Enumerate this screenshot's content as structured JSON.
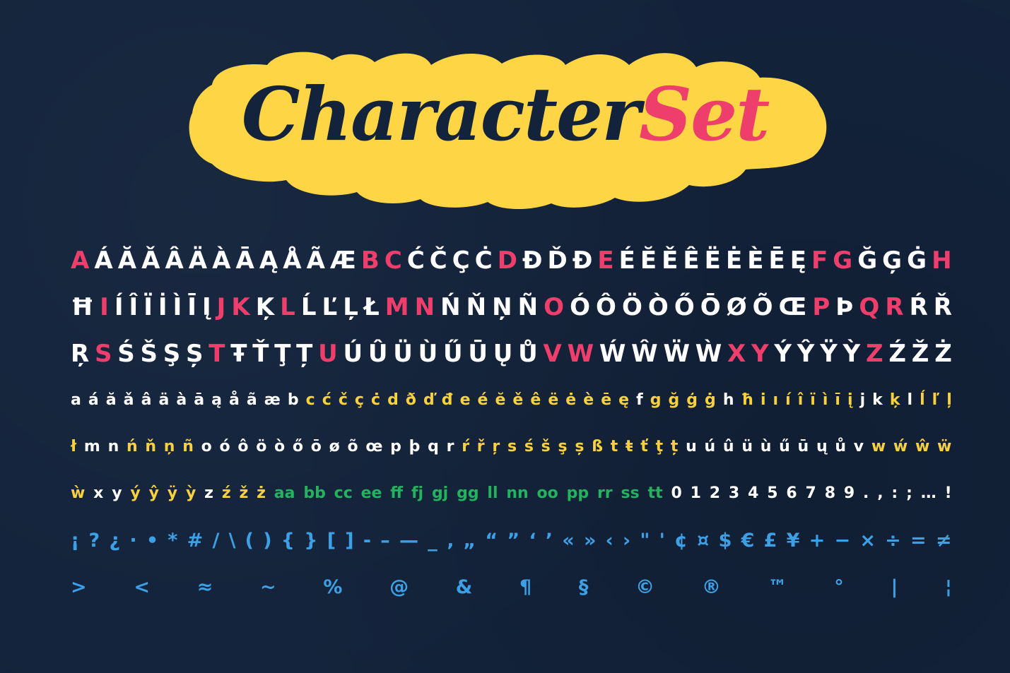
{
  "title": {
    "word1": "Character",
    "word2": "Set"
  },
  "colors": {
    "background": "#13233b",
    "cloud": "#fdd545",
    "pink": "#ee3e6c",
    "white": "#ffffff",
    "yellow": "#f9d13e",
    "green": "#22b35d",
    "blue": "#3da0e6"
  },
  "rows": [
    [
      [
        "A",
        "pink"
      ],
      [
        "Á",
        "white"
      ],
      [
        "Ă",
        "white"
      ],
      [
        "Ǎ",
        "white"
      ],
      [
        "Â",
        "white"
      ],
      [
        "Ä",
        "white"
      ],
      [
        "À",
        "white"
      ],
      [
        "Ā",
        "white"
      ],
      [
        "Ą",
        "white"
      ],
      [
        "Å",
        "white"
      ],
      [
        "Ã",
        "white"
      ],
      [
        "Æ",
        "white"
      ],
      [
        "B",
        "pink"
      ],
      [
        "C",
        "pink"
      ],
      [
        "Ć",
        "white"
      ],
      [
        "Č",
        "white"
      ],
      [
        "Ç",
        "white"
      ],
      [
        "Ċ",
        "white"
      ],
      [
        "D",
        "pink"
      ],
      [
        "Đ",
        "white"
      ],
      [
        "Ď",
        "white"
      ],
      [
        "Đ",
        "white"
      ],
      [
        "E",
        "pink"
      ],
      [
        "É",
        "white"
      ],
      [
        "Ĕ",
        "white"
      ],
      [
        "Ě",
        "white"
      ],
      [
        "Ê",
        "white"
      ],
      [
        "Ë",
        "white"
      ],
      [
        "Ė",
        "white"
      ],
      [
        "È",
        "white"
      ],
      [
        "Ē",
        "white"
      ],
      [
        "Ę",
        "white"
      ],
      [
        "F",
        "pink"
      ],
      [
        "G",
        "pink"
      ],
      [
        "Ğ",
        "white"
      ],
      [
        "Ģ",
        "white"
      ],
      [
        "Ġ",
        "white"
      ],
      [
        "H",
        "pink"
      ]
    ],
    [
      [
        "Ħ",
        "white"
      ],
      [
        "I",
        "pink"
      ],
      [
        "Í",
        "white"
      ],
      [
        "Î",
        "white"
      ],
      [
        "Ï",
        "white"
      ],
      [
        "İ",
        "white"
      ],
      [
        "Ì",
        "white"
      ],
      [
        "Ī",
        "white"
      ],
      [
        "Į",
        "white"
      ],
      [
        "J",
        "pink"
      ],
      [
        "K",
        "pink"
      ],
      [
        "Ķ",
        "white"
      ],
      [
        "L",
        "pink"
      ],
      [
        "Ĺ",
        "white"
      ],
      [
        "Ľ",
        "white"
      ],
      [
        "Ļ",
        "white"
      ],
      [
        "Ł",
        "white"
      ],
      [
        "M",
        "pink"
      ],
      [
        "N",
        "pink"
      ],
      [
        "Ń",
        "white"
      ],
      [
        "Ň",
        "white"
      ],
      [
        "Ņ",
        "white"
      ],
      [
        "Ñ",
        "white"
      ],
      [
        "O",
        "pink"
      ],
      [
        "Ó",
        "white"
      ],
      [
        "Ô",
        "white"
      ],
      [
        "Ö",
        "white"
      ],
      [
        "Ò",
        "white"
      ],
      [
        "Ő",
        "white"
      ],
      [
        "Ō",
        "white"
      ],
      [
        "Ø",
        "white"
      ],
      [
        "Õ",
        "white"
      ],
      [
        "Œ",
        "white"
      ],
      [
        "P",
        "pink"
      ],
      [
        "Þ",
        "white"
      ],
      [
        "Q",
        "pink"
      ],
      [
        "R",
        "pink"
      ],
      [
        "Ŕ",
        "white"
      ],
      [
        "Ř",
        "white"
      ]
    ],
    [
      [
        "Ŗ",
        "white"
      ],
      [
        "S",
        "pink"
      ],
      [
        "Ś",
        "white"
      ],
      [
        "Š",
        "white"
      ],
      [
        "Ş",
        "white"
      ],
      [
        "Ș",
        "white"
      ],
      [
        "T",
        "pink"
      ],
      [
        "Ŧ",
        "white"
      ],
      [
        "Ť",
        "white"
      ],
      [
        "Ţ",
        "white"
      ],
      [
        "Ț",
        "white"
      ],
      [
        "U",
        "pink"
      ],
      [
        "Ú",
        "white"
      ],
      [
        "Û",
        "white"
      ],
      [
        "Ü",
        "white"
      ],
      [
        "Ù",
        "white"
      ],
      [
        "Ű",
        "white"
      ],
      [
        "Ū",
        "white"
      ],
      [
        "Ų",
        "white"
      ],
      [
        "Ů",
        "white"
      ],
      [
        "V",
        "pink"
      ],
      [
        "W",
        "pink"
      ],
      [
        "Ẃ",
        "white"
      ],
      [
        "Ŵ",
        "white"
      ],
      [
        "Ẅ",
        "white"
      ],
      [
        "Ẁ",
        "white"
      ],
      [
        "X",
        "pink"
      ],
      [
        "Y",
        "pink"
      ],
      [
        "Ý",
        "white"
      ],
      [
        "Ŷ",
        "white"
      ],
      [
        "Ÿ",
        "white"
      ],
      [
        "Ỳ",
        "white"
      ],
      [
        "Z",
        "pink"
      ],
      [
        "Ź",
        "white"
      ],
      [
        "Ž",
        "white"
      ],
      [
        "Ż",
        "white"
      ]
    ],
    [
      [
        "a",
        "white"
      ],
      [
        "á",
        "white"
      ],
      [
        "ă",
        "white"
      ],
      [
        "ǎ",
        "white"
      ],
      [
        "â",
        "white"
      ],
      [
        "ä",
        "white"
      ],
      [
        "à",
        "white"
      ],
      [
        "ā",
        "white"
      ],
      [
        "ą",
        "white"
      ],
      [
        "å",
        "white"
      ],
      [
        "ã",
        "white"
      ],
      [
        "æ",
        "white"
      ],
      [
        "b",
        "white"
      ],
      [
        "c",
        "yellow"
      ],
      [
        "ć",
        "yellow"
      ],
      [
        "č",
        "yellow"
      ],
      [
        "ç",
        "yellow"
      ],
      [
        "ċ",
        "yellow"
      ],
      [
        "d",
        "yellow"
      ],
      [
        "ð",
        "yellow"
      ],
      [
        "ď",
        "yellow"
      ],
      [
        "đ",
        "yellow"
      ],
      [
        "e",
        "yellow"
      ],
      [
        "é",
        "yellow"
      ],
      [
        "ĕ",
        "yellow"
      ],
      [
        "ě",
        "yellow"
      ],
      [
        "ê",
        "yellow"
      ],
      [
        "ë",
        "yellow"
      ],
      [
        "ė",
        "yellow"
      ],
      [
        "è",
        "yellow"
      ],
      [
        "ē",
        "yellow"
      ],
      [
        "ę",
        "yellow"
      ],
      [
        "f",
        "white"
      ],
      [
        "g",
        "yellow"
      ],
      [
        "ğ",
        "yellow"
      ],
      [
        "ģ",
        "yellow"
      ],
      [
        "ġ",
        "yellow"
      ],
      [
        "h",
        "white"
      ],
      [
        "ħ",
        "yellow"
      ],
      [
        "i",
        "yellow"
      ],
      [
        "ı",
        "yellow"
      ],
      [
        "í",
        "yellow"
      ],
      [
        "î",
        "yellow"
      ],
      [
        "ï",
        "yellow"
      ],
      [
        "ì",
        "yellow"
      ],
      [
        "ī",
        "yellow"
      ],
      [
        "į",
        "yellow"
      ],
      [
        "j",
        "white"
      ],
      [
        "k",
        "white"
      ],
      [
        "ķ",
        "yellow"
      ],
      [
        "l",
        "white"
      ],
      [
        "ĺ",
        "yellow"
      ],
      [
        "ľ",
        "yellow"
      ],
      [
        "ļ",
        "yellow"
      ]
    ],
    [
      [
        "ł",
        "yellow"
      ],
      [
        "m",
        "white"
      ],
      [
        "n",
        "white"
      ],
      [
        "ń",
        "yellow"
      ],
      [
        "ň",
        "yellow"
      ],
      [
        "ņ",
        "yellow"
      ],
      [
        "ñ",
        "yellow"
      ],
      [
        "o",
        "white"
      ],
      [
        "ó",
        "white"
      ],
      [
        "ô",
        "white"
      ],
      [
        "ö",
        "white"
      ],
      [
        "ò",
        "white"
      ],
      [
        "ő",
        "white"
      ],
      [
        "ō",
        "white"
      ],
      [
        "ø",
        "white"
      ],
      [
        "õ",
        "white"
      ],
      [
        "œ",
        "white"
      ],
      [
        "p",
        "white"
      ],
      [
        "þ",
        "white"
      ],
      [
        "q",
        "white"
      ],
      [
        "r",
        "white"
      ],
      [
        "ŕ",
        "yellow"
      ],
      [
        "ř",
        "yellow"
      ],
      [
        "ŗ",
        "yellow"
      ],
      [
        "s",
        "yellow"
      ],
      [
        "ś",
        "yellow"
      ],
      [
        "š",
        "yellow"
      ],
      [
        "ş",
        "yellow"
      ],
      [
        "ș",
        "yellow"
      ],
      [
        "ß",
        "yellow"
      ],
      [
        "t",
        "yellow"
      ],
      [
        "ŧ",
        "yellow"
      ],
      [
        "ť",
        "yellow"
      ],
      [
        "ţ",
        "yellow"
      ],
      [
        "ț",
        "yellow"
      ],
      [
        "u",
        "white"
      ],
      [
        "ú",
        "white"
      ],
      [
        "û",
        "white"
      ],
      [
        "ü",
        "white"
      ],
      [
        "ù",
        "white"
      ],
      [
        "ű",
        "white"
      ],
      [
        "ū",
        "white"
      ],
      [
        "ų",
        "white"
      ],
      [
        "ů",
        "white"
      ],
      [
        "v",
        "white"
      ],
      [
        "w",
        "yellow"
      ],
      [
        "ẃ",
        "yellow"
      ],
      [
        "ŵ",
        "yellow"
      ],
      [
        "ẅ",
        "yellow"
      ]
    ],
    [
      [
        "ẁ",
        "yellow"
      ],
      [
        "x",
        "white"
      ],
      [
        "y",
        "white"
      ],
      [
        "ý",
        "yellow"
      ],
      [
        "ŷ",
        "yellow"
      ],
      [
        "ÿ",
        "yellow"
      ],
      [
        "ỳ",
        "yellow"
      ],
      [
        "z",
        "white"
      ],
      [
        "ź",
        "yellow"
      ],
      [
        "ž",
        "yellow"
      ],
      [
        "ż",
        "yellow"
      ],
      [
        "aa",
        "green"
      ],
      [
        "bb",
        "green"
      ],
      [
        "cc",
        "green"
      ],
      [
        "ee",
        "green"
      ],
      [
        "ff",
        "green"
      ],
      [
        "fj",
        "green"
      ],
      [
        "gj",
        "green"
      ],
      [
        "gg",
        "green"
      ],
      [
        "ll",
        "green"
      ],
      [
        "nn",
        "green"
      ],
      [
        "oo",
        "green"
      ],
      [
        "pp",
        "green"
      ],
      [
        "rr",
        "green"
      ],
      [
        "ss",
        "green"
      ],
      [
        "tt",
        "green"
      ],
      [
        "0",
        "white"
      ],
      [
        "1",
        "white"
      ],
      [
        "2",
        "white"
      ],
      [
        "3",
        "white"
      ],
      [
        "4",
        "white"
      ],
      [
        "5",
        "white"
      ],
      [
        "6",
        "white"
      ],
      [
        "7",
        "white"
      ],
      [
        "8",
        "white"
      ],
      [
        "9",
        "white"
      ],
      [
        ".",
        "white"
      ],
      [
        ",",
        "white"
      ],
      [
        ":",
        "white"
      ],
      [
        ";",
        "white"
      ],
      [
        "…",
        "white"
      ],
      [
        "!",
        "white"
      ]
    ],
    [
      [
        "¡",
        "blue"
      ],
      [
        "?",
        "blue"
      ],
      [
        "¿",
        "blue"
      ],
      [
        "·",
        "blue"
      ],
      [
        "•",
        "blue"
      ],
      [
        "*",
        "blue"
      ],
      [
        "#",
        "blue"
      ],
      [
        "/",
        "blue"
      ],
      [
        "\\",
        "blue"
      ],
      [
        "(",
        "blue"
      ],
      [
        ")",
        "blue"
      ],
      [
        "{",
        "blue"
      ],
      [
        "}",
        "blue"
      ],
      [
        "[",
        "blue"
      ],
      [
        "]",
        "blue"
      ],
      [
        "-",
        "blue"
      ],
      [
        "–",
        "blue"
      ],
      [
        "—",
        "blue"
      ],
      [
        "_",
        "blue"
      ],
      [
        "‚",
        "blue"
      ],
      [
        "„",
        "blue"
      ],
      [
        "“",
        "blue"
      ],
      [
        "”",
        "blue"
      ],
      [
        "‘",
        "blue"
      ],
      [
        "’",
        "blue"
      ],
      [
        "«",
        "blue"
      ],
      [
        "»",
        "blue"
      ],
      [
        "‹",
        "blue"
      ],
      [
        "›",
        "blue"
      ],
      [
        "\"",
        "blue"
      ],
      [
        "'",
        "blue"
      ],
      [
        "¢",
        "blue"
      ],
      [
        "¤",
        "blue"
      ],
      [
        "$",
        "blue"
      ],
      [
        "€",
        "blue"
      ],
      [
        "£",
        "blue"
      ],
      [
        "¥",
        "blue"
      ],
      [
        "+",
        "blue"
      ],
      [
        "−",
        "blue"
      ],
      [
        "×",
        "blue"
      ],
      [
        "÷",
        "blue"
      ],
      [
        "=",
        "blue"
      ],
      [
        "≠",
        "blue"
      ]
    ],
    [
      [
        ">",
        "blue"
      ],
      [
        "<",
        "blue"
      ],
      [
        "≈",
        "blue"
      ],
      [
        "~",
        "blue"
      ],
      [
        "%",
        "blue"
      ],
      [
        "@",
        "blue"
      ],
      [
        "&",
        "blue"
      ],
      [
        "¶",
        "blue"
      ],
      [
        "§",
        "blue"
      ],
      [
        "©",
        "blue"
      ],
      [
        "®",
        "blue"
      ],
      [
        "™",
        "blue"
      ],
      [
        "°",
        "blue"
      ],
      [
        "|",
        "blue"
      ],
      [
        "¦",
        "blue"
      ]
    ]
  ]
}
